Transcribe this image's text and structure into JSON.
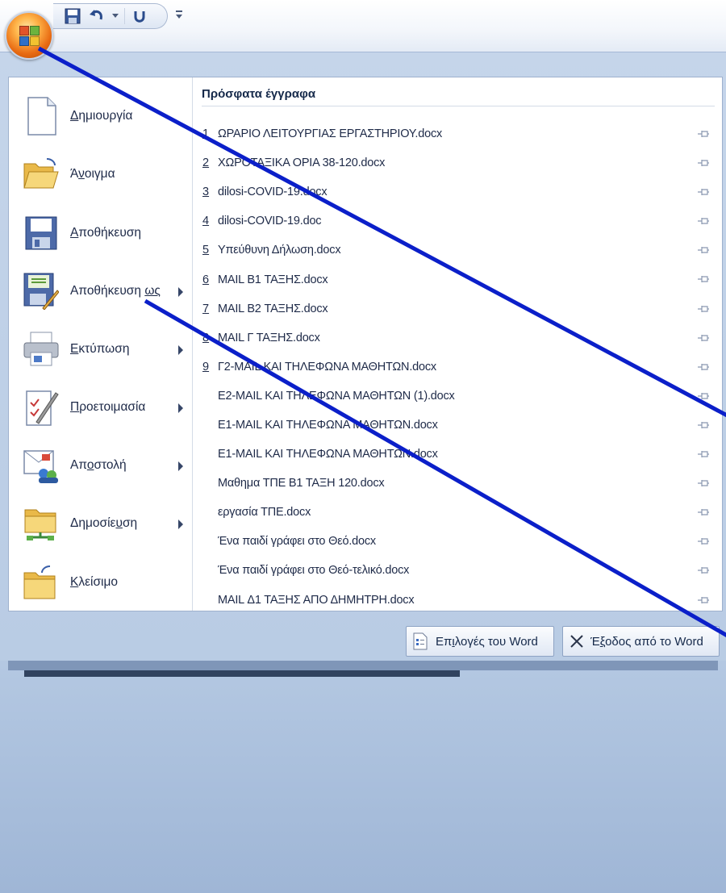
{
  "menu": {
    "commands": [
      {
        "label": "Δημιουργία",
        "accel": "Δ",
        "rest": "ημιουργία",
        "icon": "new-document-icon",
        "submenu": false
      },
      {
        "label": "Άνοιγμα",
        "pre": "Ά",
        "accel": "ν",
        "rest": "οιγμα",
        "icon": "open-folder-icon",
        "submenu": false
      },
      {
        "label": "Αποθήκευση",
        "accel": "Α",
        "rest": "ποθήκευση",
        "icon": "save-disk-icon",
        "submenu": false
      },
      {
        "label": "Αποθήκευση ως",
        "pre": "Αποθήκευση ",
        "accel": "ως",
        "rest": "",
        "icon": "save-as-icon",
        "submenu": true
      },
      {
        "label": "Εκτύπωση",
        "accel": "Ε",
        "rest": "κτύπωση",
        "icon": "printer-icon",
        "submenu": true
      },
      {
        "label": "Προετοιμασία",
        "accel": "Π",
        "rest": "ροετοιμασία",
        "icon": "prepare-icon",
        "submenu": true
      },
      {
        "label": "Αποστολή",
        "pre": "Απ",
        "accel": "ο",
        "rest": "στολή",
        "icon": "send-mail-icon",
        "submenu": true
      },
      {
        "label": "Δημοσίευση",
        "pre": "Δημοσίε",
        "accel": "υ",
        "rest": "ση",
        "icon": "publish-icon",
        "submenu": true
      },
      {
        "label": "Κλείσιμο",
        "accel": "Κ",
        "rest": "λείσιμο",
        "icon": "close-folder-icon",
        "submenu": false
      }
    ]
  },
  "recent": {
    "title": "Πρόσφατα έγγραφα",
    "docs": [
      {
        "num": "1",
        "name": "ΩΡΑΡΙΟ ΛΕΙΤΟΥΡΓΙΑΣ ΕΡΓΑΣΤΗΡΙΟΥ.docx"
      },
      {
        "num": "2",
        "name": "ΧΩΡΟΤΑΞΙΚΑ ΟΡΙΑ 38-120.docx"
      },
      {
        "num": "3",
        "name": "dilosi-COVID-19.docx"
      },
      {
        "num": "4",
        "name": "dilosi-COVID-19.doc"
      },
      {
        "num": "5",
        "name": "Υπεύθυνη Δήλωση.docx"
      },
      {
        "num": "6",
        "name": "MAIL B1 ΤΑΞΗΣ.docx"
      },
      {
        "num": "7",
        "name": "MAIL B2 ΤΑΞΗΣ.docx"
      },
      {
        "num": "8",
        "name": "MAIL Γ ΤΑΞΗΣ.docx"
      },
      {
        "num": "9",
        "name": "Γ2-MAIL ΚΑΙ ΤΗΛΕΦΩΝΑ ΜΑΘΗΤΩΝ.docx"
      },
      {
        "num": "",
        "name": "Ε2-MAIL ΚΑΙ ΤΗΛΕΦΩΝΑ ΜΑΘΗΤΩΝ (1).docx"
      },
      {
        "num": "",
        "name": "Ε1-MAIL ΚΑΙ ΤΗΛΕΦΩΝΑ ΜΑΘΗΤΩΝ.docx"
      },
      {
        "num": "",
        "name": "Ε1-MAIL ΚΑΙ ΤΗΛΕΦΩΝΑ ΜΑΘΗΤΩΝ.docx"
      },
      {
        "num": "",
        "name": "Μαθημα ΤΠΕ Β1 ΤΑΞΗ 120.docx"
      },
      {
        "num": "",
        "name": "εργασία ΤΠΕ.docx"
      },
      {
        "num": "",
        "name": "Ένα παιδί γράφει στο Θεό.docx"
      },
      {
        "num": "",
        "name": "Ένα παιδί γράφει στο Θεό-τελικό.docx"
      },
      {
        "num": "",
        "name": "MAIL Δ1 ΤΑΞΗΣ ΑΠΟ ΔΗΜΗΤΡΗ.docx"
      }
    ]
  },
  "footer": {
    "options": {
      "pre": "Επ",
      "accel": "ι",
      "rest": "λογές του Word"
    },
    "exit": {
      "pre": "Έ",
      "accel": "ξ",
      "rest": "οδος από το Word"
    }
  },
  "colors": {
    "accent_line": "#0b1fc9",
    "menu_frame": "#c5d5ea"
  }
}
